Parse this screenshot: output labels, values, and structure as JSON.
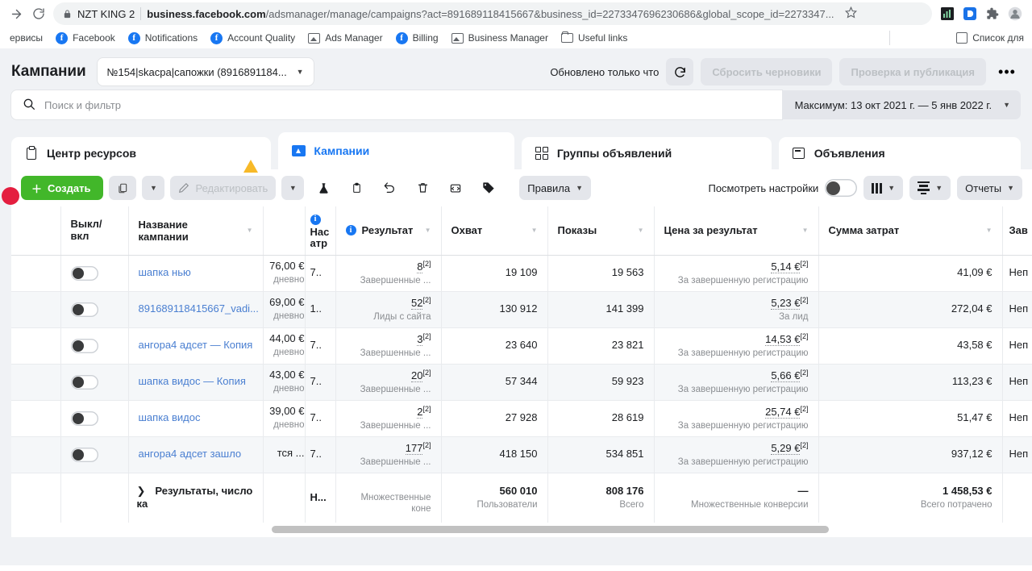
{
  "browser": {
    "site_label": "NZT KING 2",
    "url_bold": "business.facebook.com",
    "url_rest": "/adsmanager/manage/campaigns?act=891689118415667&business_id=2273347696230686&global_scope_id=2273347...",
    "bookmarks": [
      {
        "label": "ервисы",
        "icon": "none"
      },
      {
        "label": "Facebook",
        "icon": "facebook-icon"
      },
      {
        "label": "Notifications",
        "icon": "facebook-icon"
      },
      {
        "label": "Account Quality",
        "icon": "facebook-icon"
      },
      {
        "label": "Ads Manager",
        "icon": "image-icon"
      },
      {
        "label": "Billing",
        "icon": "facebook-icon"
      },
      {
        "label": "Business Manager",
        "icon": "image-icon"
      },
      {
        "label": "Useful links",
        "icon": "folder-icon"
      }
    ],
    "bookmark_right": "Список для"
  },
  "header": {
    "title": "Кампании",
    "account": "№154|skacpa|сапожки (8916891184...",
    "updated": "Обновлено только что",
    "reset_drafts": "Сбросить черновики",
    "review_publish": "Проверка и публикация",
    "more": "•••"
  },
  "search": {
    "placeholder": "Поиск и фильтр",
    "date_range": "Максимум: 13 окт 2021 г. — 5 янв 2022 г."
  },
  "tabs": [
    {
      "label": "Центр ресурсов",
      "icon": "clipboard-icon",
      "active": false
    },
    {
      "label": "Кампании",
      "icon": "campaign-folder-icon",
      "active": true
    },
    {
      "label": "Группы объявлений",
      "icon": "adset-grid-icon",
      "active": false
    },
    {
      "label": "Объявления",
      "icon": "ad-icon",
      "active": false
    }
  ],
  "toolbar": {
    "create": "Создать",
    "edit": "Редактировать",
    "rules": "Правила",
    "view_setup": "Посмотреть настройки",
    "reports": "Отчеты",
    "icons": {
      "duplicate": "duplicate-icon",
      "ab_test": "flask-icon",
      "clipboard": "clipboard-icon",
      "undo": "undo-icon",
      "delete": "trash-icon",
      "export": "export-icon",
      "tag": "tag-icon",
      "columns": "columns-icon",
      "breakdown": "breakdown-icon"
    }
  },
  "table": {
    "columns": [
      {
        "key": "checkbox",
        "label": "",
        "info": false,
        "sort": false
      },
      {
        "key": "onoff",
        "label": "Выкл/\nвкл",
        "info": false,
        "sort": false
      },
      {
        "key": "name",
        "label": "Название кампании",
        "info": false,
        "sort": true
      },
      {
        "key": "budget",
        "label": "",
        "info": false,
        "sort": false
      },
      {
        "key": "attr",
        "label": "Нас\nатр",
        "info": true,
        "sort": false
      },
      {
        "key": "result",
        "label": "Результат",
        "info": true,
        "sort": true
      },
      {
        "key": "reach",
        "label": "Охват",
        "info": false,
        "sort": true
      },
      {
        "key": "impr",
        "label": "Показы",
        "info": false,
        "sort": true
      },
      {
        "key": "cpr",
        "label": "Цена за результат",
        "info": false,
        "sort": true
      },
      {
        "key": "spend",
        "label": "Сумма затрат",
        "info": false,
        "sort": true
      },
      {
        "key": "ends",
        "label": "Зав",
        "info": false,
        "sort": false
      }
    ],
    "rows": [
      {
        "name": "шапка нью",
        "budget_main": "76,00 €",
        "budget_sub": "дневно",
        "attr": "7..",
        "result_main": "8",
        "result_sup": "[2]",
        "result_sub": "Завершенные ...",
        "reach": "19 109",
        "impr": "19 563",
        "cpr_main": "5,14 €",
        "cpr_sup": "[2]",
        "cpr_sub": "За завершенную регистрацию",
        "spend": "41,09 €",
        "ends": "Неп"
      },
      {
        "name": "891689118415667_vadi...",
        "budget_main": "69,00 €",
        "budget_sub": "дневно",
        "attr": "1..",
        "result_main": "52",
        "result_sup": "[2]",
        "result_sub": "Лиды с сайта",
        "reach": "130 912",
        "impr": "141 399",
        "cpr_main": "5,23 €",
        "cpr_sup": "[2]",
        "cpr_sub": "За лид",
        "spend": "272,04 €",
        "ends": "Неп"
      },
      {
        "name": "ангора4 адсет — Копия",
        "budget_main": "44,00 €",
        "budget_sub": "дневно",
        "attr": "7..",
        "result_main": "3",
        "result_sup": "[2]",
        "result_sub": "Завершенные ...",
        "reach": "23 640",
        "impr": "23 821",
        "cpr_main": "14,53 €",
        "cpr_sup": "[2]",
        "cpr_sub": "За завершенную регистрацию",
        "spend": "43,58 €",
        "ends": "Неп"
      },
      {
        "name": "шапка видос — Копия",
        "budget_main": "43,00 €",
        "budget_sub": "дневно",
        "attr": "7..",
        "result_main": "20",
        "result_sup": "[2]",
        "result_sub": "Завершенные ...",
        "reach": "57 344",
        "impr": "59 923",
        "cpr_main": "5,66 €",
        "cpr_sup": "[2]",
        "cpr_sub": "За завершенную регистрацию",
        "spend": "113,23 €",
        "ends": "Неп"
      },
      {
        "name": "шапка видос",
        "budget_main": "39,00 €",
        "budget_sub": "дневно",
        "attr": "7..",
        "result_main": "2",
        "result_sup": "[2]",
        "result_sub": "Завершенные ...",
        "reach": "27 928",
        "impr": "28 619",
        "cpr_main": "25,74 €",
        "cpr_sup": "[2]",
        "cpr_sub": "За завершенную регистрацию",
        "spend": "51,47 €",
        "ends": "Неп"
      },
      {
        "name": "ангора4 адсет зашло",
        "budget_main": "тся ...",
        "budget_sub": "",
        "attr": "7..",
        "result_main": "177",
        "result_sup": "[2]",
        "result_sub": "Завершенные ...",
        "reach": "418 150",
        "impr": "534 851",
        "cpr_main": "5,29 €",
        "cpr_sup": "[2]",
        "cpr_sub": "За завершенную регистрацию",
        "spend": "937,12 €",
        "ends": "Неп"
      }
    ],
    "total": {
      "label": "Результаты, число ка",
      "attr": "Н...",
      "result_sub": "Множественные коне",
      "reach_main": "560 010",
      "reach_sub": "Пользователи",
      "impr_main": "808 176",
      "impr_sub": "Всего",
      "cpr_main": "—",
      "cpr_sub": "Множественные конверсии",
      "spend_main": "1 458,53 €",
      "spend_sub": "Всего потрачено"
    }
  },
  "colors": {
    "accent": "#1877f2",
    "create_green": "#42b72a",
    "warn": "#f7b928",
    "link": "#4a7fd1"
  }
}
